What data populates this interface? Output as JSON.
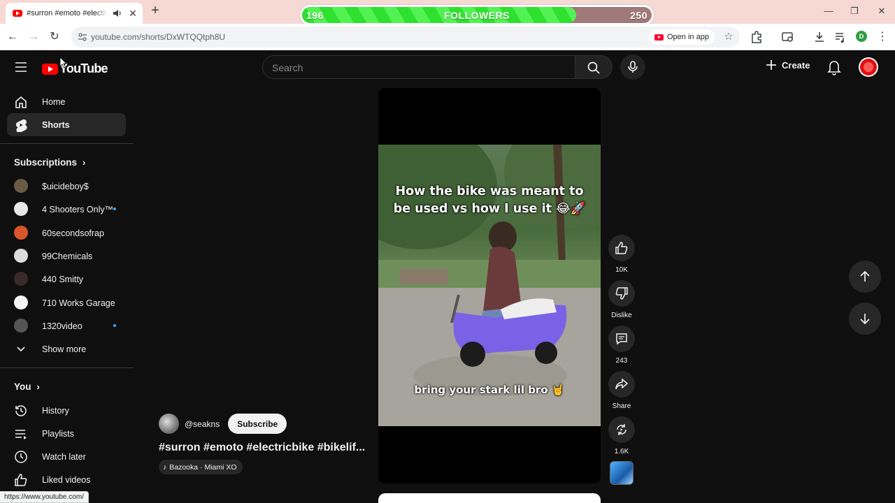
{
  "browser": {
    "tab_title": "#surron #emoto #electricbike",
    "url": "youtube.com/shorts/DxWTQQtph8U",
    "open_in_app_label": "Open in app",
    "profile_initial": "D",
    "status_url": "https://www.youtube.com/"
  },
  "follower_widget": {
    "current": "196",
    "label": "FOLLOWERS",
    "goal": "250",
    "progress_fraction": 0.784,
    "fill_color": "#38e838"
  },
  "youtube": {
    "logo_text": "YouTube",
    "search_placeholder": "Search",
    "create_label": "Create",
    "nav": [
      {
        "label": "Home",
        "icon": "home-icon"
      },
      {
        "label": "Shorts",
        "icon": "shorts-icon"
      }
    ],
    "subscriptions_title": "Subscriptions",
    "subscriptions": [
      {
        "label": "$uicideboy$",
        "new": false,
        "color": "#6b5a44"
      },
      {
        "label": "4 Shooters Only™",
        "new": true,
        "color": "#e8e8e8"
      },
      {
        "label": "60secondsofrap",
        "new": false,
        "color": "#d9552b"
      },
      {
        "label": "99Chemicals",
        "new": false,
        "color": "#dcdcdc"
      },
      {
        "label": "440 Smitty",
        "new": false,
        "color": "#3a2a2a"
      },
      {
        "label": "710 Works Garage",
        "new": false,
        "color": "#f4f4f4"
      },
      {
        "label": "1320video",
        "new": true,
        "color": "#555555"
      }
    ],
    "show_more_label": "Show more",
    "you_title": "You",
    "you_items": [
      {
        "label": "History",
        "icon": "history-icon"
      },
      {
        "label": "Playlists",
        "icon": "playlists-icon"
      },
      {
        "label": "Watch later",
        "icon": "watch-later-icon"
      },
      {
        "label": "Liked videos",
        "icon": "liked-videos-icon"
      }
    ]
  },
  "short": {
    "caption_top": "How the bike was meant to be used vs how I use it 😂🚀",
    "caption_bottom": "bring your stark lil bro 🤘",
    "channel": "@seakns",
    "subscribe_label": "Subscribe",
    "title": "#surron #emoto #electricbike #bikelif...",
    "music": "Bazooka · Miami XO",
    "actions": {
      "likes": "10K",
      "dislike_label": "Dislike",
      "comments": "243",
      "share_label": "Share",
      "remix": "1.6K"
    }
  }
}
